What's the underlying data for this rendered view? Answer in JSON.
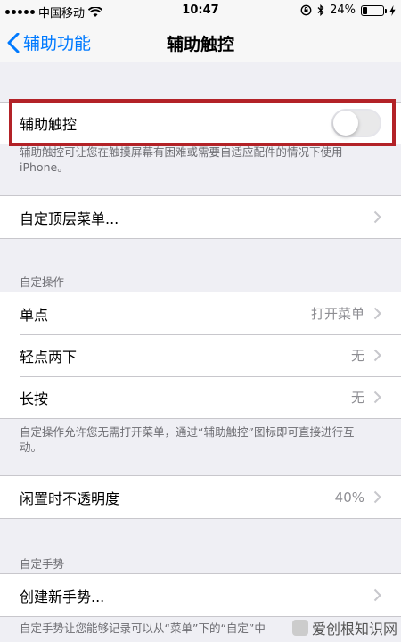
{
  "status_bar": {
    "carrier": "中国移动",
    "time": "10:47",
    "battery_percent": "24%",
    "battery_level": 0.24
  },
  "nav": {
    "back_label": "辅助功能",
    "title": "辅助触控"
  },
  "assistive_touch": {
    "label": "辅助触控",
    "enabled": false,
    "footer": "辅助触控可让您在触摸屏幕有困难或需要自适应配件的情况下使用 iPhone。"
  },
  "top_level_menu": {
    "label": "自定顶层菜单..."
  },
  "custom_actions": {
    "header": "自定操作",
    "items": [
      {
        "label": "单点",
        "value": "打开菜单"
      },
      {
        "label": "轻点两下",
        "value": "无"
      },
      {
        "label": "长按",
        "value": "无"
      }
    ],
    "footer": "自定操作允许您无需打开菜单，通过“辅助触控”图标即可直接进行互动。"
  },
  "idle_opacity": {
    "label": "闲置时不透明度",
    "value": "40%"
  },
  "custom_gestures": {
    "header": "自定手势",
    "create_label": "创建新手势...",
    "footer": "自定手势让您能够记录可以从“菜单”下的“自定”中"
  },
  "watermark": {
    "text": "爱创根知识网"
  }
}
